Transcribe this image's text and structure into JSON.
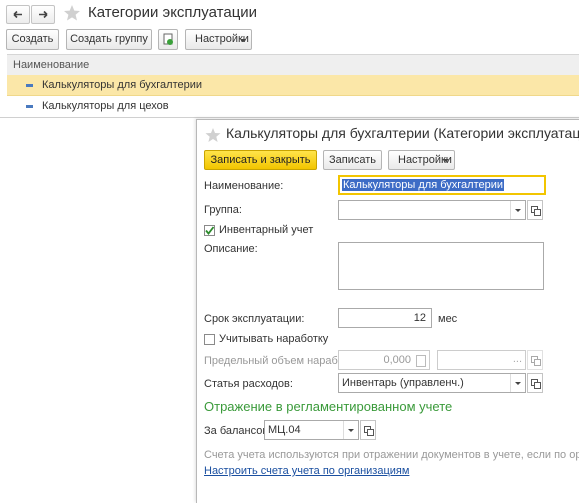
{
  "main": {
    "title": "Категории эксплуатации",
    "toolbar": {
      "create": "Создать",
      "create_group": "Создать группу",
      "settings": "Настройки"
    },
    "list": {
      "column_header": "Наименование",
      "rows": [
        "Калькуляторы для бухгалтерии",
        "Калькуляторы для цехов"
      ]
    }
  },
  "form": {
    "title": "Калькуляторы для бухгалтерии (Категории эксплуатации)",
    "toolbar": {
      "write_close": "Записать и закрыть",
      "write": "Записать",
      "settings": "Настройки"
    },
    "name_label": "Наименование:",
    "name_value": "Калькуляторы для бухгалтерии",
    "group_label": "Группа:",
    "group_value": "",
    "inventory_label": "Инвентарный учет",
    "inventory_checked": true,
    "description_label": "Описание:",
    "description_value": "",
    "lifetime_label": "Срок эксплуатации:",
    "lifetime_value": "12",
    "lifetime_unit": "мес",
    "track_usage_label": "Учитывать наработку",
    "track_usage_checked": false,
    "max_usage_label": "Предельный объем наработки:",
    "max_usage_value": "0,000",
    "max_usage_unit_value": "",
    "expense_label": "Статья расходов:",
    "expense_value": "Инвентарь (управленч.)",
    "section_title": "Отражение в регламентированном учете",
    "offbalance_label": "За балансом:",
    "offbalance_value": "МЦ.04",
    "note": "Счета учета используются при отражении документов в учете, если по организации не к",
    "link": "Настроить счета учета по организациям"
  },
  "colors": {
    "selection": "#fbe7a8",
    "accent_yellow": "#f2c500",
    "section_green": "#3a9a3a",
    "link_blue": "#1a4fa0"
  }
}
